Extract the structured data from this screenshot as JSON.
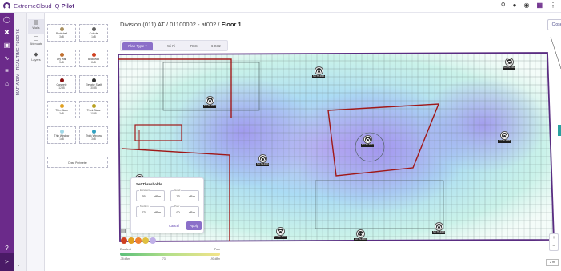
{
  "app": {
    "brand_prefix": "ExtremeCloud IQ ",
    "brand_suffix": "Pilot"
  },
  "topbar": {
    "icons": [
      "search-icon",
      "bell-icon",
      "user-icon",
      "apps-icon",
      "more-icon"
    ]
  },
  "rail": {
    "help_icon": "?",
    "expand_icon": ">"
  },
  "vertical_tab": {
    "label": "MAFIA/DIV - REAL TIME FLOORS"
  },
  "tools": [
    {
      "label": "Walls"
    },
    {
      "label": "Attenuate"
    },
    {
      "label": "Layers"
    }
  ],
  "wall_types": [
    {
      "name": "Bookshelf",
      "db": "3dB",
      "color": "#a89060"
    },
    {
      "name": "Cubicle",
      "db": "1dB",
      "color": "#606060"
    },
    {
      "name": "Dry Wall",
      "db": "3dB",
      "color": "#c07030"
    },
    {
      "name": "Brick Wall",
      "db": "8dB",
      "color": "#d04020"
    },
    {
      "name": "Concrete",
      "db": "12dB",
      "color": "#8a1010"
    },
    {
      "name": "Elevator Shaft",
      "db": "30dB",
      "color": "#303030"
    },
    {
      "name": "Thin Glass",
      "db": "3dB",
      "color": "#e0a020"
    },
    {
      "name": "Thick Glass",
      "db": "10dB",
      "color": "#b8a020"
    },
    {
      "name": "Thin Window",
      "db": "1dB",
      "color": "#a0d8e8"
    },
    {
      "name": "Thick Window",
      "db": "3dB",
      "color": "#30a0c0"
    }
  ],
  "draw_button": "Draw Perimeter",
  "breadcrumb": {
    "path": "Division (011) AT  /  01100002 - at002  /  ",
    "current": "Floor 1"
  },
  "close_label": "Close",
  "view_bar": {
    "selected": "Plan Type",
    "options": [
      "Wi-Fi",
      "RSSI",
      "6 GHz"
    ]
  },
  "aps": [
    {
      "label": "SU-TN-0001"
    },
    {
      "label": "SU-TN-0002"
    },
    {
      "label": "SU-TN-0003"
    },
    {
      "label": "SU-TN-0004"
    },
    {
      "label": "SU-TN-0005"
    },
    {
      "label": "SU-TN-0006"
    },
    {
      "label": "SU-TN-0007"
    },
    {
      "label": "SU-TN-0008"
    },
    {
      "label": "SU-TN-0009"
    },
    {
      "label": "SU-TN-0010"
    }
  ],
  "thresholds": {
    "title": "Set Thresholds",
    "fields": [
      {
        "label": "Excellent",
        "value": "-35",
        "unit": "dBm"
      },
      {
        "label": "Good",
        "value": "-73",
        "unit": "dBm"
      },
      {
        "label": "Medium",
        "value": "-73",
        "unit": "dBm"
      },
      {
        "label": "Poor",
        "value": "-90",
        "unit": "dBm"
      }
    ],
    "cancel": "Cancel",
    "apply": "Apply"
  },
  "swatch_colors": [
    "#d04020",
    "#e0a020",
    "#f08030",
    "#e0c040",
    "#c0b0e8"
  ],
  "legend": {
    "left_title": "Excellent",
    "right_title": "Poor",
    "ticks": [
      "-35 dBm",
      "-73",
      "-90 dBm"
    ]
  },
  "zoom": {
    "plus": "+",
    "minus": "−"
  },
  "scale_label": "2 m"
}
